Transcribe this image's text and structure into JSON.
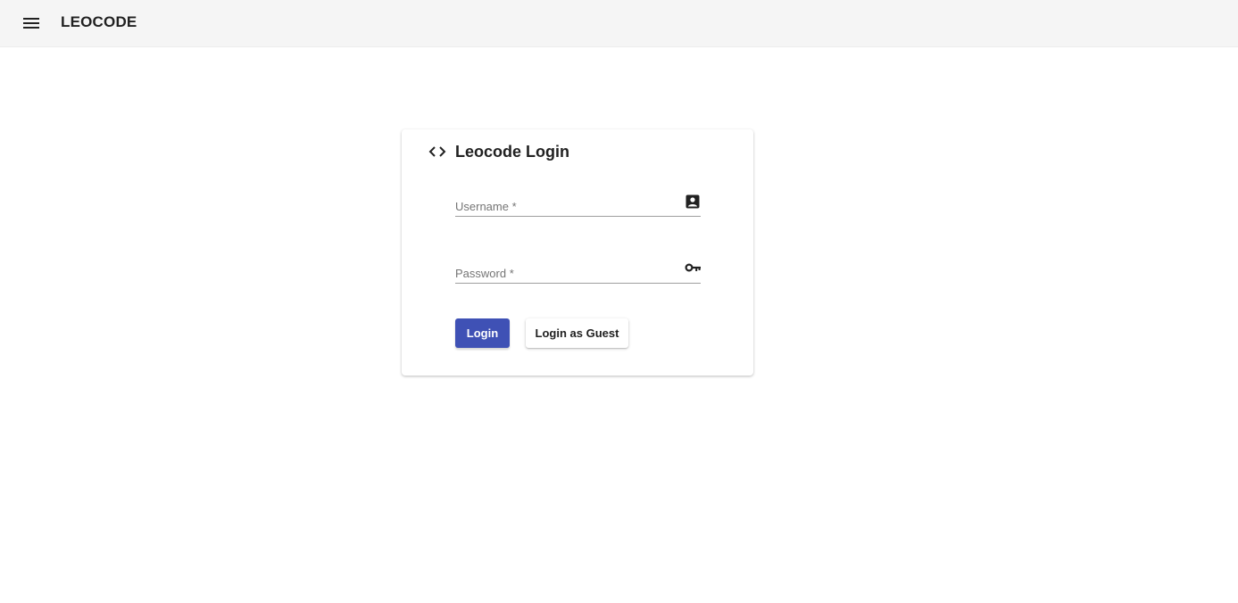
{
  "app_bar": {
    "title": "LEOCODE",
    "menu_icon": "menu-icon",
    "background": "#f5f5f5"
  },
  "login_card": {
    "title": "Leocode Login",
    "header_icon": "code-icon",
    "username": {
      "label": "Username *",
      "value": "",
      "icon": "account-box-icon"
    },
    "password": {
      "label": "Password *",
      "value": "",
      "icon": "key-icon"
    },
    "login_button": "Login",
    "guest_button": "Login as Guest",
    "accent_color": "#3f51b5"
  }
}
